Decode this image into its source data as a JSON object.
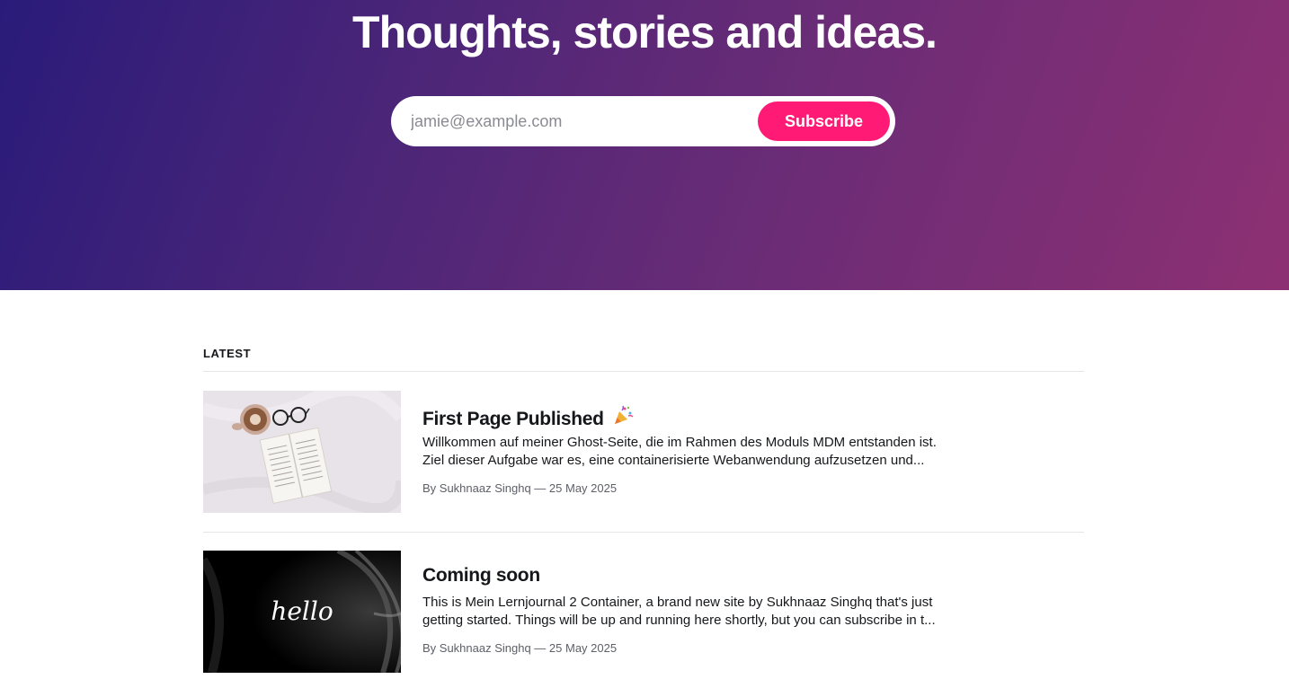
{
  "hero": {
    "title": "Thoughts, stories and ideas.",
    "email_placeholder": "jamie@example.com",
    "subscribe_label": "Subscribe"
  },
  "colors": {
    "hero_gradient_start": "#2a1b7a",
    "hero_gradient_end": "#8d3073",
    "accent": "#ff1a75"
  },
  "feed": {
    "section_label": "LATEST",
    "posts": [
      {
        "title": "First Page Published",
        "title_icon": "party-popper-icon",
        "excerpt_line1": "Willkommen auf meiner Ghost-Seite, die im Rahmen des Moduls MDM entstanden ist.",
        "excerpt_line2": "Ziel dieser Aufgabe war es, eine containerisierte Webanwendung aufzusetzen und...",
        "meta": "By Sukhnaaz Singhq — 25 May 2025",
        "image": "book-coffee-glasses"
      },
      {
        "title": "Coming soon",
        "excerpt_line1": "This is Mein Lernjournal 2 Container, a brand new site by Sukhnaaz Singhq that's just",
        "excerpt_line2": "getting started. Things will be up and running here shortly, but you can subscribe in t...",
        "meta": "By Sukhnaaz Singhq — 25 May 2025",
        "image": "hello-dark",
        "image_text": "hello"
      }
    ]
  }
}
